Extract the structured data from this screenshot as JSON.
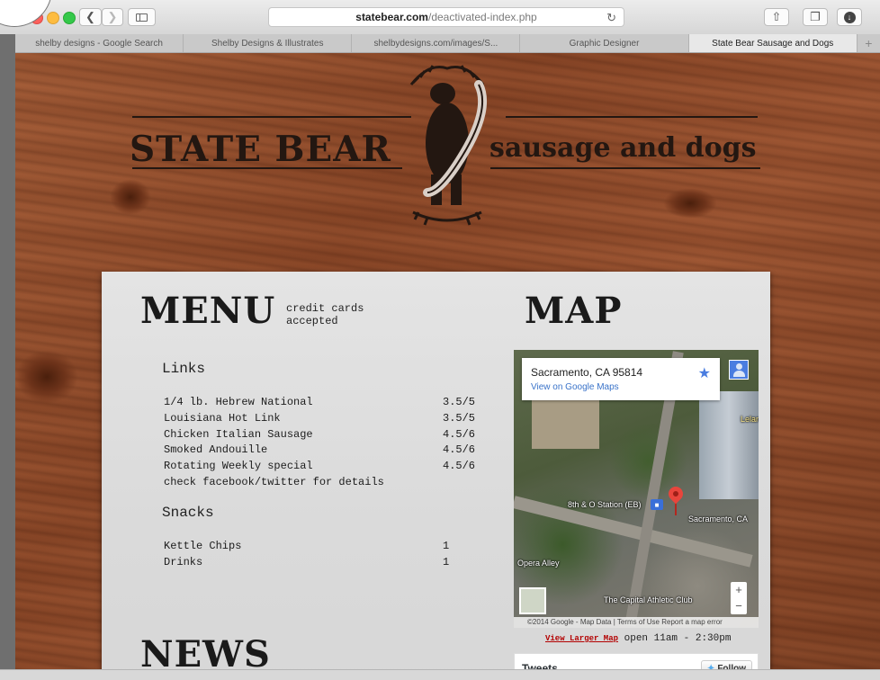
{
  "browser": {
    "url_domain": "statebear.com",
    "url_path": "/deactivated-index.php",
    "tabs": [
      {
        "label": "shelby designs - Google Search",
        "active": false
      },
      {
        "label": "Shelby Designs & Illustrates",
        "active": false
      },
      {
        "label": "shelbydesigns.com/images/S...",
        "active": false
      },
      {
        "label": "Graphic Designer",
        "active": false
      },
      {
        "label": "State Bear Sausage and Dogs",
        "active": true
      }
    ],
    "add_tab_glyph": "+",
    "icons": [
      "back-icon",
      "forward-icon",
      "sidebar-icon",
      "reload-icon",
      "share-icon",
      "tabs-icon",
      "download-icon"
    ]
  },
  "header": {
    "logo_left": "STATE BEAR",
    "logo_right": "sausage and dogs"
  },
  "menu": {
    "title": "MENU",
    "payment_note": "credit cards accepted",
    "sections": [
      {
        "name": "Links",
        "items": [
          {
            "name": "1/4 lb. Hebrew National",
            "price": "3.5/5"
          },
          {
            "name": "Louisiana Hot Link",
            "price": "3.5/5"
          },
          {
            "name": "Chicken Italian Sausage",
            "price": "4.5/6"
          },
          {
            "name": "Smoked Andouille",
            "price": "4.5/6"
          },
          {
            "name": "Rotating Weekly special",
            "price": "4.5/6"
          }
        ],
        "note": "check facebook/twitter for details"
      },
      {
        "name": "Snacks",
        "items": [
          {
            "name": "Kettle Chips",
            "price": "1"
          },
          {
            "name": "Drinks",
            "price": "1"
          }
        ]
      }
    ]
  },
  "news": {
    "title": "NEWS"
  },
  "map": {
    "title": "MAP",
    "location": "Sacramento, CA 95814",
    "view_link": "View on Google Maps",
    "labels": {
      "station": "8th & O Station (EB)",
      "city": "Sacramento, CA",
      "alley": "Opera Alley",
      "club": "The Capital Athletic Club",
      "corner": "Leland Sto"
    },
    "footer": "©2014 Google - Map Data | Terms of Use   Report a map error",
    "zoom_in": "+",
    "zoom_out": "−",
    "larger_link": "View Larger Map",
    "hours": "open 11am - 2:30pm"
  },
  "tweets": {
    "title": "Tweets",
    "follow_label": "Follow"
  },
  "colors": {
    "wood": "#8c4727",
    "ink": "#231711",
    "paper": "#e0e0e0",
    "link_red": "#b30000",
    "maps_blue": "#3a73c9",
    "twitter_blue": "#55acee"
  }
}
